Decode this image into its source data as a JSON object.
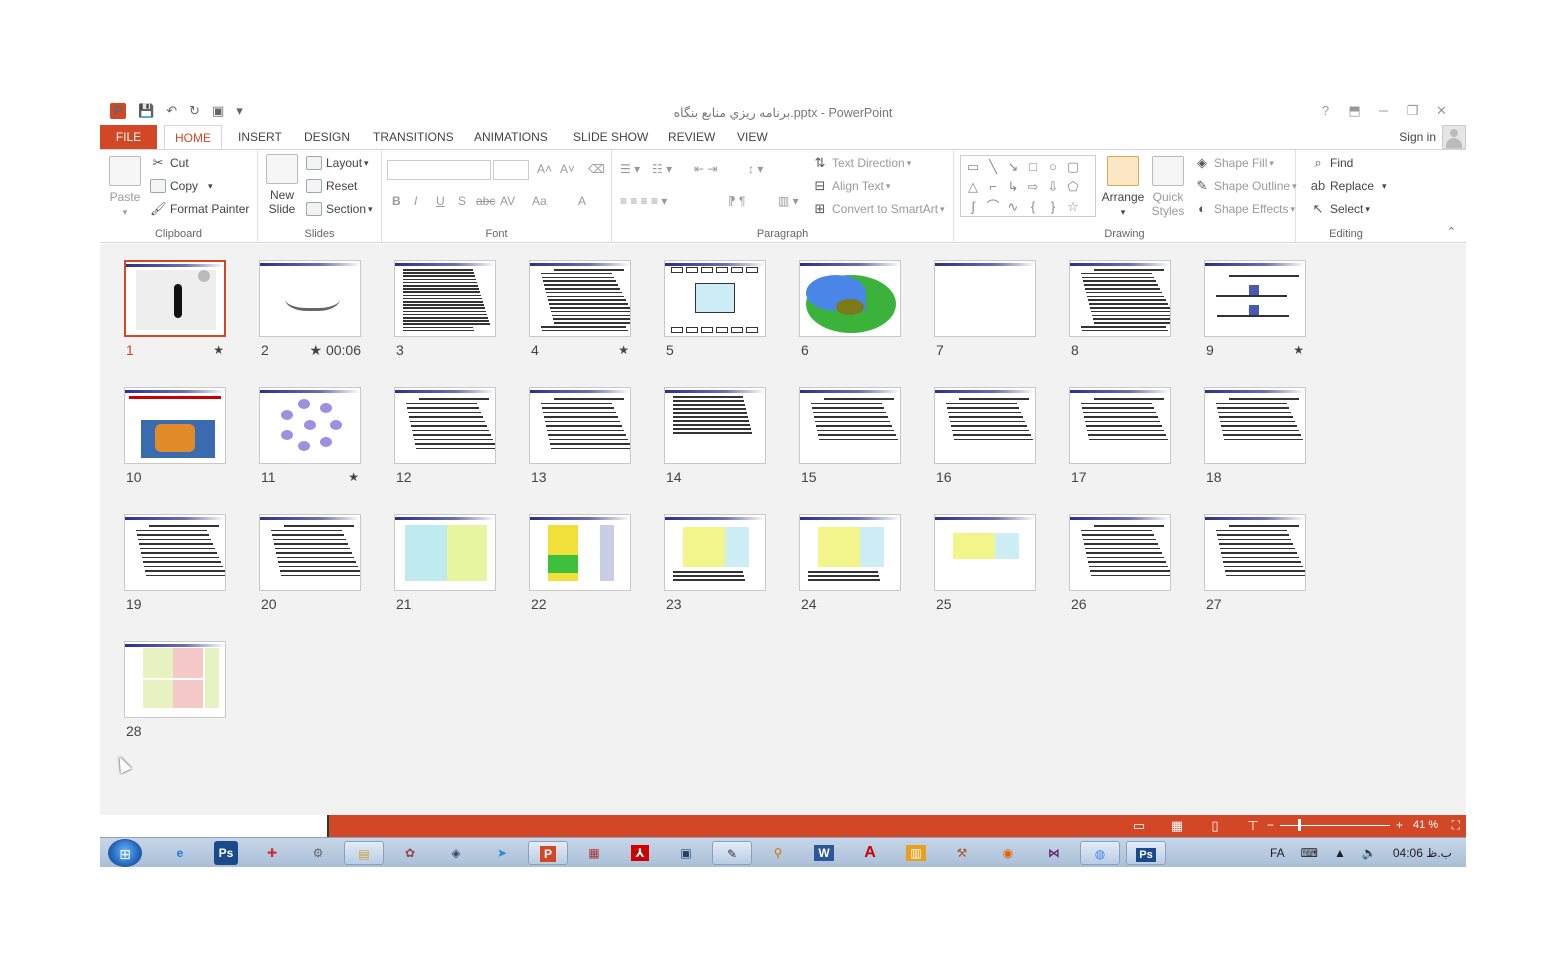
{
  "window": {
    "title": "برنامه ریزي منابع بنگاه.pptx - PowerPoint",
    "help": "?",
    "ribbon_display": "⬒",
    "minimize": "─",
    "restore": "❐",
    "close": "✕"
  },
  "qat": {
    "app_icon": "P",
    "save": "💾",
    "undo": "↶",
    "redo": "↻",
    "present": "▣",
    "customize": "▾"
  },
  "tabs": {
    "file": "FILE",
    "home": "HOME",
    "insert": "INSERT",
    "design": "DESIGN",
    "transitions": "TRANSITIONS",
    "animations": "ANIMATIONS",
    "slideshow": "SLIDE SHOW",
    "review": "REVIEW",
    "view": "VIEW"
  },
  "account": {
    "signin": "Sign in"
  },
  "ribbon": {
    "clipboard": {
      "label": "Clipboard",
      "paste": "Paste",
      "cut": "Cut",
      "copy": "Copy",
      "format_painter": "Format Painter"
    },
    "slides": {
      "label": "Slides",
      "new_slide_1": "New",
      "new_slide_2": "Slide",
      "layout": "Layout",
      "reset": "Reset",
      "section": "Section"
    },
    "font": {
      "label": "Font",
      "bold": "B",
      "italic": "I",
      "underline": "U",
      "shadow": "S",
      "strike": "abc",
      "spacing": "AV",
      "case": "Aa",
      "color": "A",
      "grow": "A˄",
      "shrink": "A˅",
      "clear": "⌫"
    },
    "paragraph": {
      "label": "Paragraph",
      "text_direction": "Text Direction",
      "align_text": "Align Text",
      "smartart": "Convert to SmartArt"
    },
    "drawing": {
      "label": "Drawing",
      "arrange": "Arrange",
      "quick_styles_1": "Quick",
      "quick_styles_2": "Styles",
      "shape_fill": "Shape Fill",
      "shape_outline": "Shape Outline",
      "shape_effects": "Shape Effects"
    },
    "editing": {
      "label": "Editing",
      "find": "Find",
      "replace": "Replace",
      "select": "Select"
    }
  },
  "slides": [
    {
      "num": "1",
      "star": "★",
      "time": ""
    },
    {
      "num": "2",
      "star": "★",
      "time": "00:06"
    },
    {
      "num": "3",
      "star": "",
      "time": ""
    },
    {
      "num": "4",
      "star": "★",
      "time": ""
    },
    {
      "num": "5",
      "star": "",
      "time": ""
    },
    {
      "num": "6",
      "star": "",
      "time": ""
    },
    {
      "num": "7",
      "star": "",
      "time": ""
    },
    {
      "num": "8",
      "star": "",
      "time": ""
    },
    {
      "num": "9",
      "star": "★",
      "time": ""
    },
    {
      "num": "10",
      "star": "",
      "time": ""
    },
    {
      "num": "11",
      "star": "★",
      "time": ""
    },
    {
      "num": "12",
      "star": "",
      "time": ""
    },
    {
      "num": "13",
      "star": "",
      "time": ""
    },
    {
      "num": "14",
      "star": "",
      "time": ""
    },
    {
      "num": "15",
      "star": "",
      "time": ""
    },
    {
      "num": "16",
      "star": "",
      "time": ""
    },
    {
      "num": "17",
      "star": "",
      "time": ""
    },
    {
      "num": "18",
      "star": "",
      "time": ""
    },
    {
      "num": "19",
      "star": "",
      "time": ""
    },
    {
      "num": "20",
      "star": "",
      "time": ""
    },
    {
      "num": "21",
      "star": "",
      "time": ""
    },
    {
      "num": "22",
      "star": "",
      "time": ""
    },
    {
      "num": "23",
      "star": "",
      "time": ""
    },
    {
      "num": "24",
      "star": "",
      "time": ""
    },
    {
      "num": "25",
      "star": "",
      "time": ""
    },
    {
      "num": "26",
      "star": "",
      "time": ""
    },
    {
      "num": "27",
      "star": "",
      "time": ""
    },
    {
      "num": "28",
      "star": "",
      "time": ""
    }
  ],
  "selected_slide": "1",
  "status": {
    "zoom": "41 %",
    "zoom_level_percent": 41,
    "minus": "−",
    "plus": "+"
  },
  "taskbar": {
    "lang": "FA",
    "clock": "04:06 ب.ظ"
  },
  "colors": {
    "accent": "#d24726"
  }
}
